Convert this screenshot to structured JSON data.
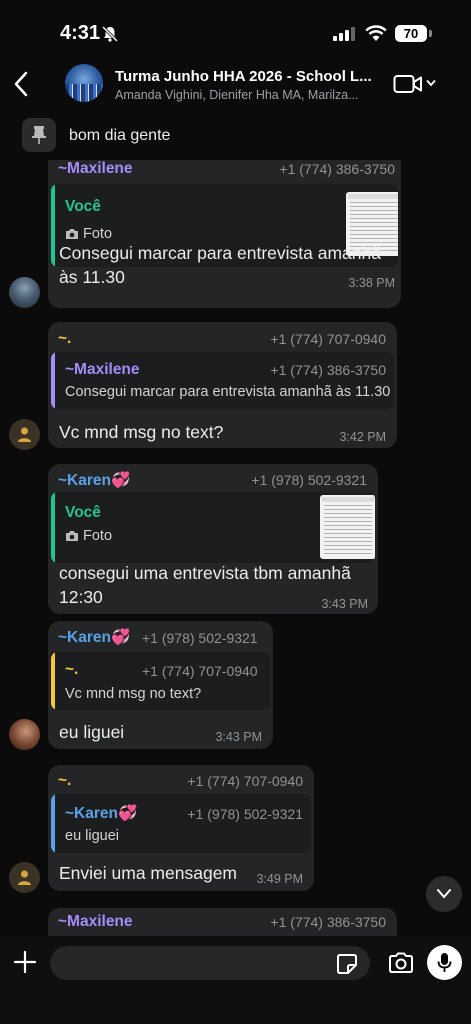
{
  "status_bar": {
    "time": "4:31",
    "battery": "70"
  },
  "header": {
    "title": "Turma Junho HHA 2026 - School L...",
    "subtitle": "Amanda Vighini, Dienifer Hha MA, Marilza..."
  },
  "pinned": {
    "text": "bom dia gente"
  },
  "messages": [
    {
      "sender": "~Maxilene",
      "phone": "+1 (774) 386-3750",
      "quote": {
        "author": "Você",
        "text": "Foto"
      },
      "body_line1": "Consegui marcar para entrevista amanhã",
      "body_line2": "às 11.30",
      "time": "3:38 PM"
    },
    {
      "sender": "~.",
      "phone": "+1 (774) 707-0940",
      "quote": {
        "author": "~Maxilene",
        "phone": "+1 (774) 386-3750",
        "text": "Consegui marcar para entrevista amanhã às 11.30"
      },
      "body": "Vc mnd msg no text?",
      "time": "3:42 PM"
    },
    {
      "sender": "~Karen💞",
      "phone": "+1 (978) 502-9321",
      "quote": {
        "author": "Você",
        "text": "Foto"
      },
      "body_line1": "consegui uma entrevista tbm amanhã",
      "body_line2": "12:30",
      "time": "3:43 PM"
    },
    {
      "sender": "~Karen💞",
      "phone": "+1 (978) 502-9321",
      "quote": {
        "author": "~.",
        "phone": "+1 (774) 707-0940",
        "text": "Vc mnd msg no text?"
      },
      "body": "eu liguei",
      "time": "3:43 PM"
    },
    {
      "sender": "~.",
      "phone": "+1 (774) 707-0940",
      "quote": {
        "author": "~Karen💞",
        "phone": "+1 (978) 502-9321",
        "text": "eu liguei"
      },
      "body": "Enviei uma mensagem",
      "time": "3:49 PM"
    },
    {
      "sender": "~Maxilene",
      "phone": "+1 (774) 386-3750"
    }
  ],
  "composer": {
    "placeholder": ""
  },
  "colors": {
    "maxilene": "#a78bfa",
    "dot": "#f5c542",
    "karen": "#5aa2e8",
    "voce": "#22c493",
    "bubble": "#242526",
    "quote_bg": "#1c1d1e"
  },
  "icons": [
    "bell-slash-icon",
    "signal-icon",
    "wifi-icon",
    "back-icon",
    "video-icon",
    "chevron-down-icon",
    "pin-icon",
    "camera-small-icon",
    "person-icon",
    "plus-icon",
    "sticker-icon",
    "camera-icon",
    "mic-icon"
  ]
}
